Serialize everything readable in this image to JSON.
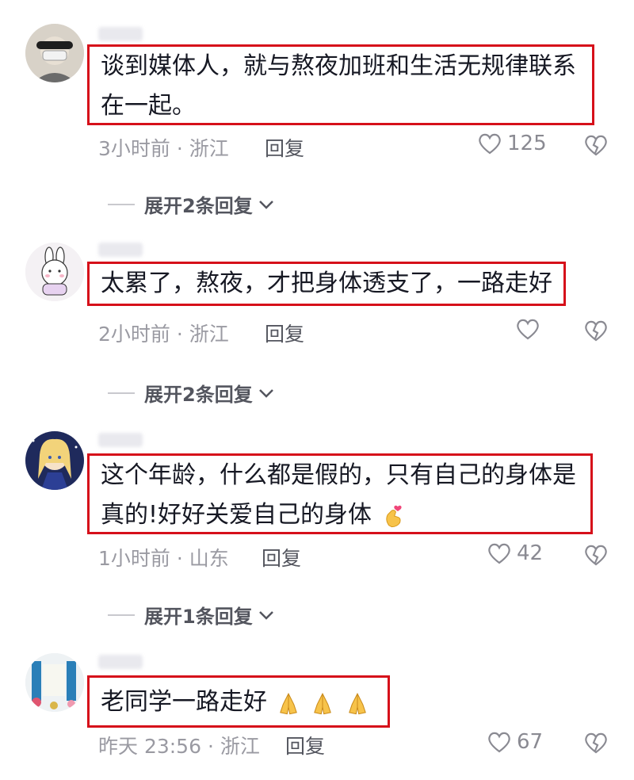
{
  "comments": [
    {
      "text": "谈到媒体人，就与熬夜加班和生活无规律联系在一起。",
      "time_location": "3小时前 · 浙江",
      "reply_label": "回复",
      "likes": "125",
      "expand_label": "展开2条回复"
    },
    {
      "text": "太累了，熬夜，才把身体透支了，一路走好",
      "time_location": "2小时前 · 浙江",
      "reply_label": "回复",
      "likes": "",
      "expand_label": "展开2条回复"
    },
    {
      "text": "这个年龄，什么都是假的，只有自己的身体是真的!好好关爱自己的身体",
      "emoji": "finger-heart",
      "time_location": "1小时前 · 山东",
      "reply_label": "回复",
      "likes": "42",
      "expand_label": "展开1条回复"
    },
    {
      "text": "老同学一路走好",
      "emoji": "folded-hands x3",
      "time_location": "昨天 23:56 · 浙江",
      "reply_label": "回复",
      "likes": "67"
    }
  ],
  "colors": {
    "highlight_border": "#d6101a",
    "meta_text": "#9a9aa2",
    "reply_text": "#53555e"
  }
}
